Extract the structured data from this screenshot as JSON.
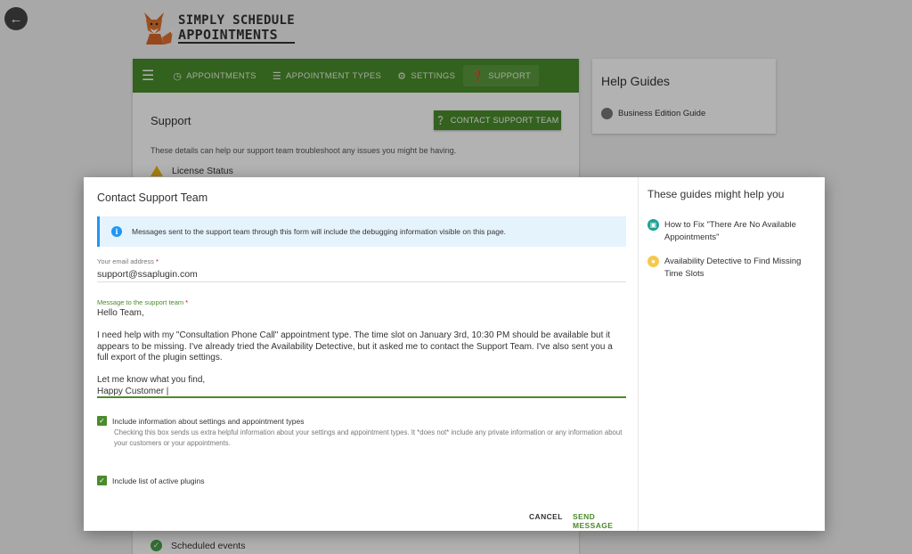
{
  "logo": {
    "line1": "SIMPLY SCHEDULE",
    "line2": "APPOINTMENTS"
  },
  "nav": {
    "items": [
      {
        "label": "APPOINTMENTS",
        "icon": "clock-icon"
      },
      {
        "label": "APPOINTMENT TYPES",
        "icon": "list-icon"
      },
      {
        "label": "SETTINGS",
        "icon": "gear-icon"
      },
      {
        "label": "SUPPORT",
        "icon": "help-icon"
      }
    ]
  },
  "support": {
    "title": "Support",
    "contact_button": "CONTACT SUPPORT TEAM",
    "description": "These details can help our support team troubleshoot any issues you might be having.",
    "license_status": "License Status",
    "scheduled_events": "Scheduled events"
  },
  "help": {
    "title": "Help Guides",
    "item": "Business Edition Guide"
  },
  "modal": {
    "title": "Contact Support Team",
    "info": "Messages sent to the support team through this form will include the debugging information visible on this page.",
    "email_label": "Your email address",
    "email_value": "support@ssaplugin.com",
    "message_label": "Message to the support team",
    "message": {
      "greeting": "Hello Team,",
      "body": "I need help with my \"Consultation Phone Call\" appointment type. The time slot on January 3rd, 10:30 PM should be available but it appears to be missing. I've already tried the Availability Detective, but it asked me to contact the Support Team. I've also sent you a full export of the plugin settings.",
      "closing": "Let me know what you find,",
      "signature": "Happy Customer"
    },
    "checkbox1_label": "Include information about settings and appointment types",
    "checkbox1_help": "Checking this box sends us extra helpful information about your settings and appointment types. It *does not* include any private information or any information about your customers or your appointments.",
    "checkbox2_label": "Include list of active plugins",
    "cancel": "CANCEL",
    "send": "SEND MESSAGE",
    "guides_title": "These guides might help you",
    "guides": [
      "How to Fix \"There Are No Available Appointments\"",
      "Availability Detective to Find Missing Time Slots"
    ]
  }
}
